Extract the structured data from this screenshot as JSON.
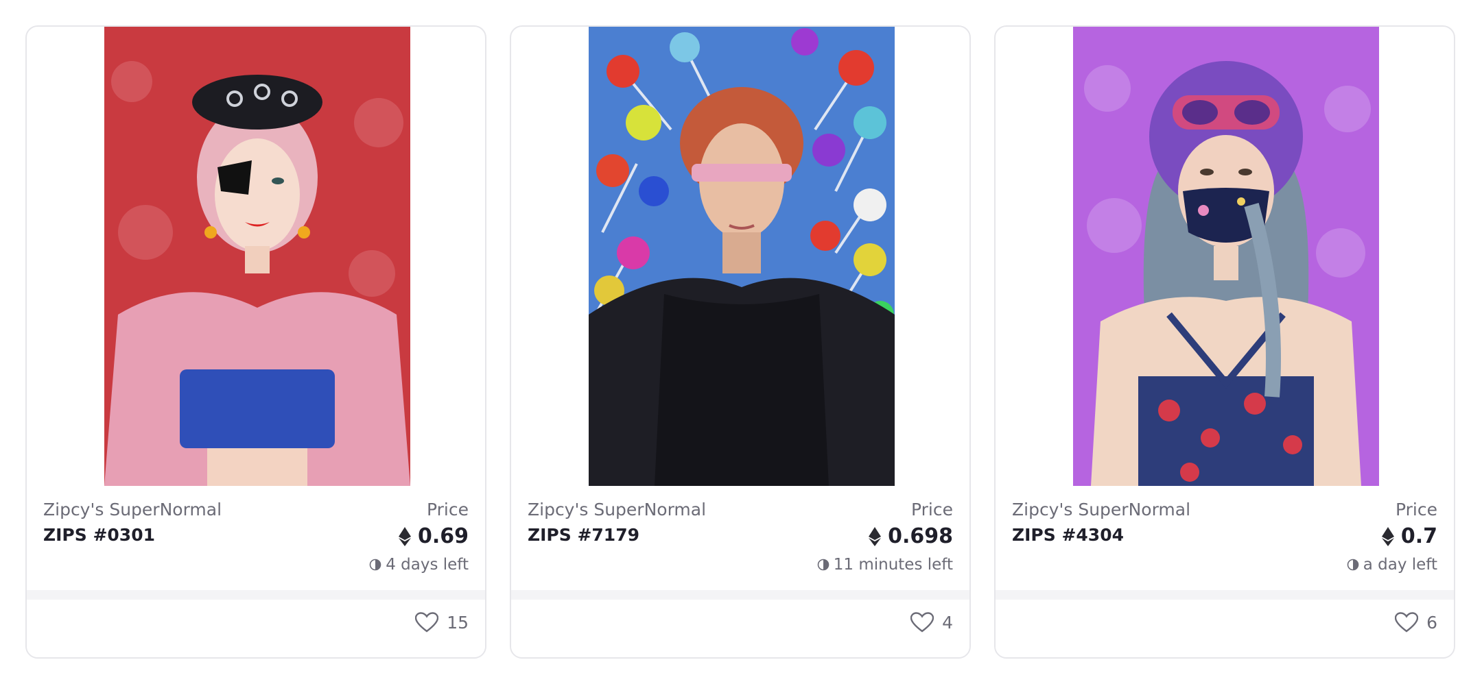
{
  "cards": [
    {
      "collection": "Zipcy's SuperNormal",
      "token": "ZIPS #0301",
      "price_label": "Price",
      "price": "0.69",
      "time_left": "4 days left",
      "likes": "15",
      "art": {
        "bg": "#c93a40",
        "hair": "#e9b3be",
        "top": "#e79fb4",
        "accent": "#2f4fb8"
      }
    },
    {
      "collection": "Zipcy's SuperNormal",
      "token": "ZIPS #7179",
      "price_label": "Price",
      "price": "0.698",
      "time_left": "11 minutes left",
      "likes": "4",
      "art": {
        "bg": "#4b7fd1",
        "hair": "#c45a3a",
        "top": "#141419",
        "accent": "#e8a6c0"
      }
    },
    {
      "collection": "Zipcy's SuperNormal",
      "token": "ZIPS #4304",
      "price_label": "Price",
      "price": "0.7",
      "time_left": "a day left",
      "likes": "6",
      "art": {
        "bg": "#b664e0",
        "hair": "#7b8fa3",
        "top": "#2d3d7a",
        "accent": "#7a4cc0"
      }
    }
  ],
  "icons": {
    "currency": "ethereum-icon",
    "timer": "clock-icon",
    "favorite": "heart-icon"
  }
}
